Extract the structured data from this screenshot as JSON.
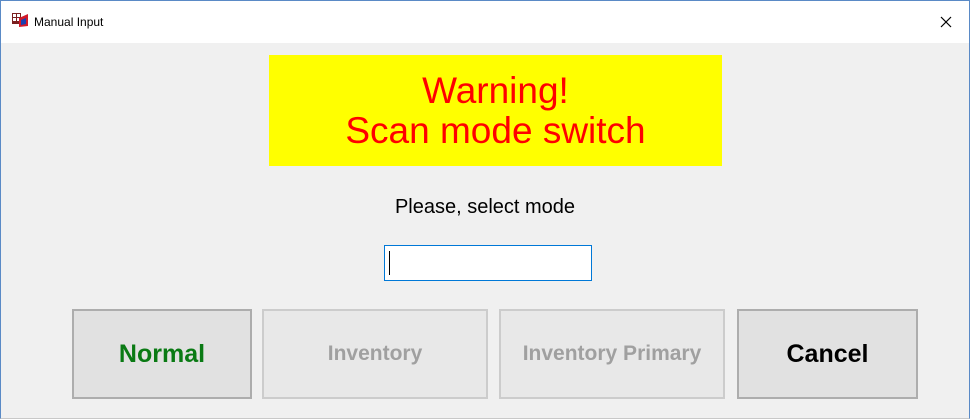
{
  "window": {
    "title": "Manual Input",
    "app_icon": "app-icon",
    "close_icon": "close-icon"
  },
  "warning": {
    "line1": "Warning!",
    "line2": "Scan mode switch",
    "background_color": "#ffff00",
    "text_color": "#ff0000"
  },
  "prompt": "Please, select mode",
  "mode_input": {
    "value": "",
    "placeholder": ""
  },
  "buttons": {
    "normal": {
      "label": "Normal",
      "enabled": true,
      "color": "#0a7a14"
    },
    "inventory": {
      "label": "Inventory",
      "enabled": false
    },
    "inventory_primary": {
      "label": "Inventory Primary",
      "enabled": false
    },
    "cancel": {
      "label": "Cancel",
      "enabled": true
    }
  }
}
